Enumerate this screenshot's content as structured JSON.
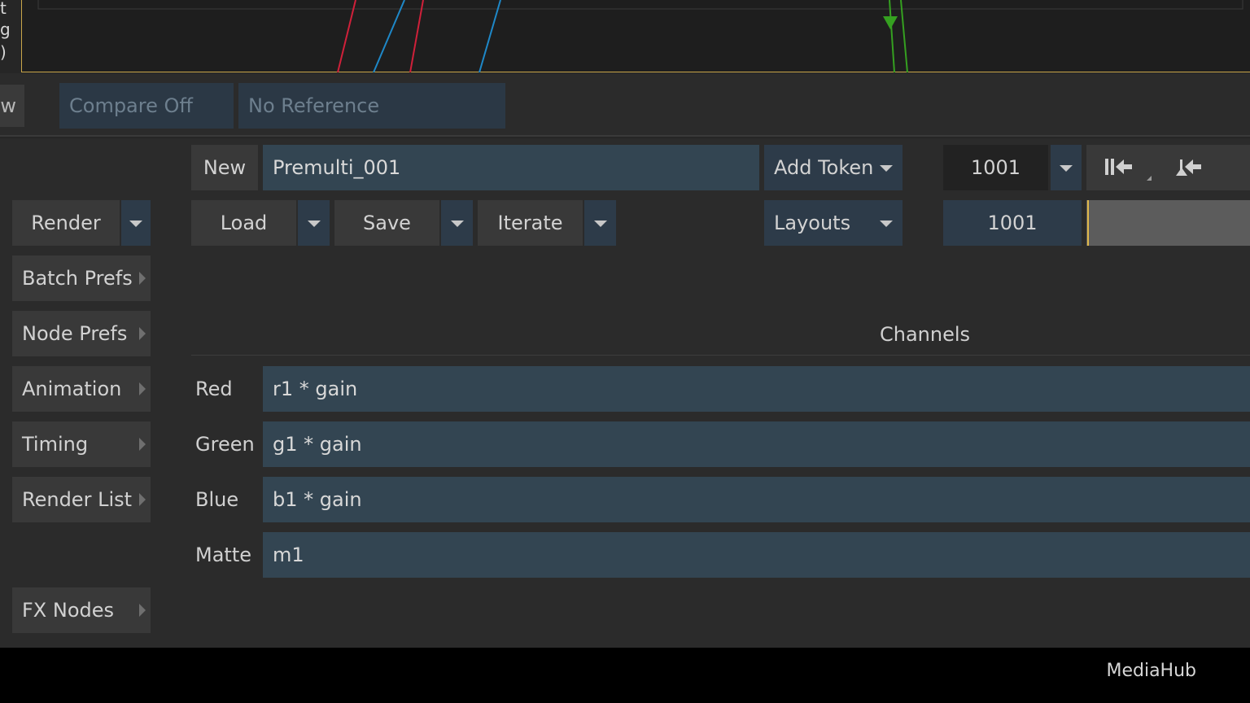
{
  "graph": {
    "side_glyphs": [
      "t",
      "g",
      ")"
    ],
    "colors": {
      "red": "#d0203a",
      "blue": "#1e88c8",
      "green": "#35a020",
      "frame": "#c9a64a"
    }
  },
  "compare": {
    "view_label": "w",
    "compare_label": "Compare Off",
    "reference_label": "No Reference"
  },
  "sidebar": {
    "render_label": "Render",
    "items": [
      {
        "label": "Batch Prefs"
      },
      {
        "label": "Node Prefs"
      },
      {
        "label": "Animation"
      },
      {
        "label": "Timing"
      },
      {
        "label": "Render List"
      },
      {
        "label": "FX Nodes"
      }
    ]
  },
  "toolbar": {
    "new_label": "New",
    "node_name": "Premulti_001",
    "add_token_label": "Add Token",
    "load_label": "Load",
    "save_label": "Save",
    "iterate_label": "Iterate",
    "layouts_label": "Layouts"
  },
  "frames": {
    "top_frame": "1001",
    "current_frame": "1001"
  },
  "channels": {
    "title": "Channels",
    "rows": [
      {
        "label": "Red",
        "value": "r1 * gain"
      },
      {
        "label": "Green",
        "value": "g1 * gain"
      },
      {
        "label": "Blue",
        "value": "b1 * gain"
      },
      {
        "label": "Matte",
        "value": "m1"
      }
    ]
  },
  "footer": {
    "app_label": "MediaHub"
  }
}
